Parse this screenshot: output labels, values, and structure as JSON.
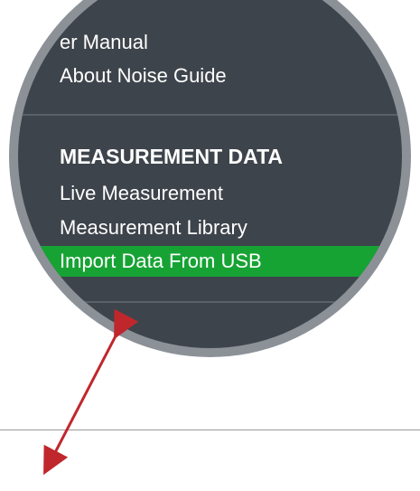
{
  "menu": {
    "help_items": [
      {
        "label": "er Manual"
      },
      {
        "label": "About Noise Guide"
      }
    ],
    "measurement_section": {
      "heading": "MEASUREMENT DATA",
      "items": [
        {
          "label": "Live Measurement"
        },
        {
          "label": "Measurement Library"
        },
        {
          "label": "Import Data From USB",
          "selected": true
        }
      ]
    }
  },
  "colors": {
    "menu_background": "#3e444b",
    "selected_highlight": "#17a334",
    "magnifier_rim": "#8c9198",
    "annotation_arrow": "#c0272d"
  },
  "icons": {
    "pointer": "annotation-arrow-icon"
  }
}
